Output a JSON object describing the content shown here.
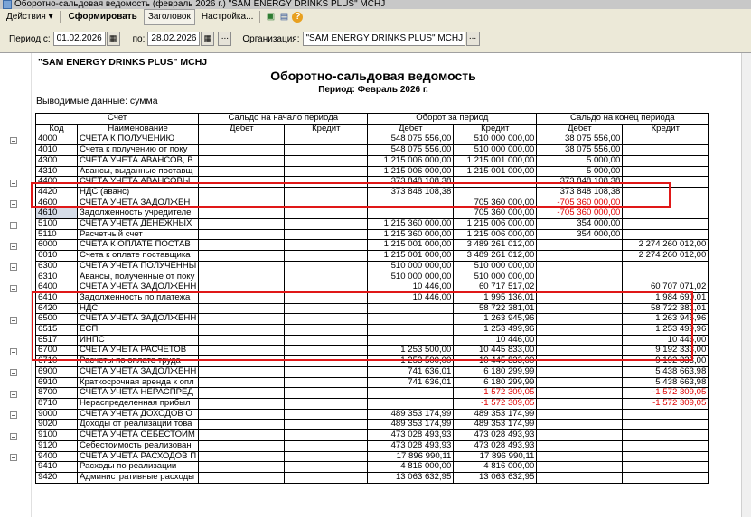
{
  "window": {
    "title": "Оборотно-сальдовая ведомость (февраль 2026 г.) \"SAM ENERGY DRINKS PLUS\" MCHJ"
  },
  "toolbar": {
    "actions_label": "Действия",
    "generate_label": "Сформировать",
    "header_label": "Заголовок",
    "settings_label": "Настройка..."
  },
  "params": {
    "period_from_label": "Период с:",
    "period_from": "01.02.2026",
    "period_to_label": "по:",
    "period_to": "28.02.2026",
    "org_label": "Организация:",
    "org_value": "\"SAM ENERGY DRINKS PLUS\" MCHJ"
  },
  "report": {
    "company": "\"SAM ENERGY DRINKS PLUS\" MCHJ",
    "title": "Оборотно-сальдовая ведомость",
    "period": "Период: Февраль 2026 г.",
    "output": "Выводимые данные: сумма",
    "headers": {
      "account": "Счет",
      "opening": "Сальдо на начало периода",
      "turnover": "Оборот за период",
      "closing": "Сальдо на конец периода",
      "code": "Код",
      "name": "Наименование",
      "debit": "Дебет",
      "credit": "Кредит"
    },
    "rows": [
      {
        "code": "4000",
        "name": "СЧЕТА К ПОЛУЧЕНИЮ",
        "od": "",
        "oc": "",
        "td": "548 075 556,00",
        "tc": "510 000 000,00",
        "cd": "38 075 556,00",
        "cc": ""
      },
      {
        "code": "4010",
        "name": "Счета к получению от поку",
        "od": "",
        "oc": "",
        "td": "548 075 556,00",
        "tc": "510 000 000,00",
        "cd": "38 075 556,00",
        "cc": ""
      },
      {
        "code": "4300",
        "name": "СЧЕТА УЧЕТА АВАНСОВ, В",
        "od": "",
        "oc": "",
        "td": "1 215 006 000,00",
        "tc": "1 215 001 000,00",
        "cd": "5 000,00",
        "cc": ""
      },
      {
        "code": "4310",
        "name": "Авансы, выданные поставщ",
        "od": "",
        "oc": "",
        "td": "1 215 006 000,00",
        "tc": "1 215 001 000,00",
        "cd": "5 000,00",
        "cc": ""
      },
      {
        "code": "4400",
        "name": "СЧЕТА УЧЕТА АВАНСОВЫ",
        "od": "",
        "oc": "",
        "td": "373 848 108,38",
        "tc": "",
        "cd": "373 848 108,38",
        "cc": ""
      },
      {
        "code": "4420",
        "name": "НДС (аванс)",
        "od": "",
        "oc": "",
        "td": "373 848 108,38",
        "tc": "",
        "cd": "373 848 108,38",
        "cc": ""
      },
      {
        "code": "4600",
        "name": "СЧЕТА УЧЕТА ЗАДОЛЖЕН",
        "od": "",
        "oc": "",
        "td": "",
        "tc": "705 360 000,00",
        "cd": "-705 360 000,00",
        "cc": ""
      },
      {
        "code": "4610",
        "name": "Задолженность учредителе",
        "od": "",
        "oc": "",
        "td": "",
        "tc": "705 360 000,00",
        "cd": "-705 360 000,00",
        "cc": ""
      },
      {
        "code": "5100",
        "name": "СЧЕТА УЧЕТА ДЕНЕЖНЫХ",
        "od": "",
        "oc": "",
        "td": "1 215 360 000,00",
        "tc": "1 215 006 000,00",
        "cd": "354 000,00",
        "cc": ""
      },
      {
        "code": "5110",
        "name": "Расчетный счет",
        "od": "",
        "oc": "",
        "td": "1 215 360 000,00",
        "tc": "1 215 006 000,00",
        "cd": "354 000,00",
        "cc": ""
      },
      {
        "code": "6000",
        "name": "СЧЕТА К ОПЛАТЕ ПОСТАВ",
        "od": "",
        "oc": "",
        "td": "1 215 001 000,00",
        "tc": "3 489 261 012,00",
        "cd": "",
        "cc": "2 274 260 012,00"
      },
      {
        "code": "6010",
        "name": "Счета к оплате поставщика",
        "od": "",
        "oc": "",
        "td": "1 215 001 000,00",
        "tc": "3 489 261 012,00",
        "cd": "",
        "cc": "2 274 260 012,00"
      },
      {
        "code": "6300",
        "name": "СЧЕТА УЧЕТА ПОЛУЧЕННЫ",
        "od": "",
        "oc": "",
        "td": "510 000 000,00",
        "tc": "510 000 000,00",
        "cd": "",
        "cc": ""
      },
      {
        "code": "6310",
        "name": "Авансы, полученные от поку",
        "od": "",
        "oc": "",
        "td": "510 000 000,00",
        "tc": "510 000 000,00",
        "cd": "",
        "cc": ""
      },
      {
        "code": "6400",
        "name": "СЧЕТА УЧЕТА ЗАДОЛЖЕНН",
        "od": "",
        "oc": "",
        "td": "10 446,00",
        "tc": "60 717 517,02",
        "cd": "",
        "cc": "60 707 071,02"
      },
      {
        "code": "6410",
        "name": "Задолженность по платежа",
        "od": "",
        "oc": "",
        "td": "10 446,00",
        "tc": "1 995 136,01",
        "cd": "",
        "cc": "1 984 690,01"
      },
      {
        "code": "6420",
        "name": "НДС",
        "od": "",
        "oc": "",
        "td": "",
        "tc": "58 722 381,01",
        "cd": "",
        "cc": "58 722 381,01"
      },
      {
        "code": "6500",
        "name": "СЧЕТА УЧЕТА ЗАДОЛЖЕНН",
        "od": "",
        "oc": "",
        "td": "",
        "tc": "1 263 945,96",
        "cd": "",
        "cc": "1 263 945,96"
      },
      {
        "code": "6515",
        "name": "ЕСП",
        "od": "",
        "oc": "",
        "td": "",
        "tc": "1 253 499,96",
        "cd": "",
        "cc": "1 253 499,96"
      },
      {
        "code": "6517",
        "name": "ИНПС",
        "od": "",
        "oc": "",
        "td": "",
        "tc": "10 446,00",
        "cd": "",
        "cc": "10 446,00"
      },
      {
        "code": "6700",
        "name": "СЧЕТА УЧЕТА РАСЧЕТОВ",
        "od": "",
        "oc": "",
        "td": "1 253 500,00",
        "tc": "10 445 833,00",
        "cd": "",
        "cc": "9 192 333,00"
      },
      {
        "code": "6710",
        "name": "Расчеты по оплате труда",
        "od": "",
        "oc": "",
        "td": "1 253 500,00",
        "tc": "10 445 833,00",
        "cd": "",
        "cc": "9 192 333,00"
      },
      {
        "code": "6900",
        "name": "СЧЕТА УЧЕТА ЗАДОЛЖЕНН",
        "od": "",
        "oc": "",
        "td": "741 636,01",
        "tc": "6 180 299,99",
        "cd": "",
        "cc": "5 438 663,98"
      },
      {
        "code": "6910",
        "name": "Краткосрочная аренда к опл",
        "od": "",
        "oc": "",
        "td": "741 636,01",
        "tc": "6 180 299,99",
        "cd": "",
        "cc": "5 438 663,98"
      },
      {
        "code": "8700",
        "name": "СЧЕТА УЧЕТА НЕРАСПРЕД",
        "od": "",
        "oc": "",
        "td": "",
        "tc": "-1 572 309,05",
        "cd": "",
        "cc": "-1 572 309,05"
      },
      {
        "code": "8710",
        "name": "Нераспределенная прибыл",
        "od": "",
        "oc": "",
        "td": "",
        "tc": "-1 572 309,05",
        "cd": "",
        "cc": "-1 572 309,05"
      },
      {
        "code": "9000",
        "name": "СЧЕТА УЧЕТА ДОХОДОВ О",
        "od": "",
        "oc": "",
        "td": "489 353 174,99",
        "tc": "489 353 174,99",
        "cd": "",
        "cc": ""
      },
      {
        "code": "9020",
        "name": "Доходы от реализации това",
        "od": "",
        "oc": "",
        "td": "489 353 174,99",
        "tc": "489 353 174,99",
        "cd": "",
        "cc": ""
      },
      {
        "code": "9100",
        "name": "СЧЕТА УЧЕТА СЕБЕСТОИМ",
        "od": "",
        "oc": "",
        "td": "473 028 493,93",
        "tc": "473 028 493,93",
        "cd": "",
        "cc": ""
      },
      {
        "code": "9120",
        "name": "Себестоимость реализован",
        "od": "",
        "oc": "",
        "td": "473 028 493,93",
        "tc": "473 028 493,93",
        "cd": "",
        "cc": ""
      },
      {
        "code": "9400",
        "name": "СЧЕТА УЧЕТА РАСХОДОВ П",
        "od": "",
        "oc": "",
        "td": "17 896 990,11",
        "tc": "17 896 990,11",
        "cd": "",
        "cc": ""
      },
      {
        "code": "9410",
        "name": "Расходы по реализации",
        "od": "",
        "oc": "",
        "td": "4 816 000,00",
        "tc": "4 816 000,00",
        "cd": "",
        "cc": ""
      },
      {
        "code": "9420",
        "name": "Административные расходы",
        "od": "",
        "oc": "",
        "td": "13 063 632,95",
        "tc": "13 063 632,95",
        "cd": "",
        "cc": ""
      }
    ]
  },
  "colors": {
    "negative": "#e00000",
    "highlight_box": "#e01818",
    "selected_row": "#d6dde8"
  }
}
